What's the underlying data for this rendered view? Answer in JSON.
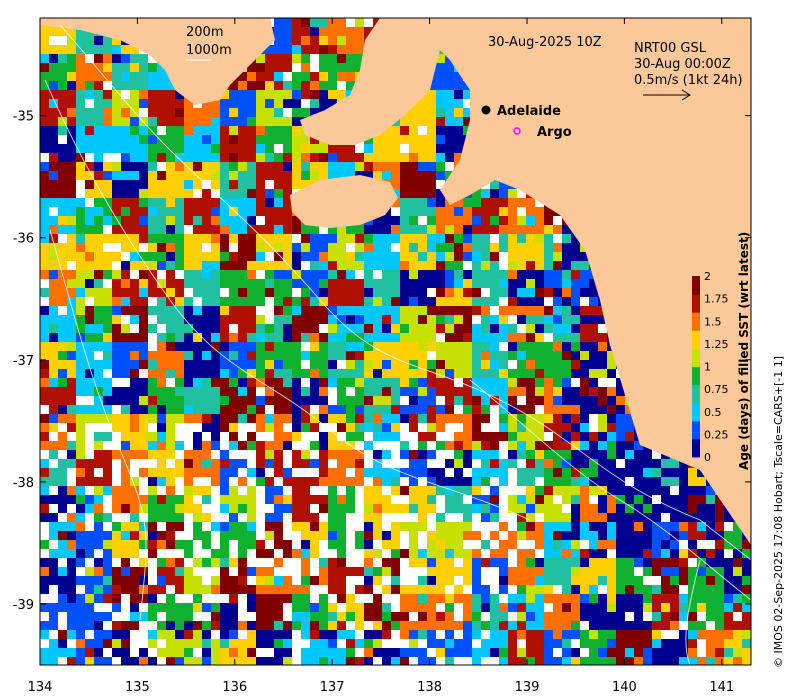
{
  "map": {
    "title_date": "30-Aug-2025 10Z",
    "depth_contours": [
      "200m",
      "1000m"
    ],
    "product": [
      "NRT00 GSL",
      "30-Aug 00:00Z",
      "0.5m/s (1kt 24h)"
    ],
    "places": [
      {
        "name": "Adelaide",
        "marker": "filled-circle",
        "lon": 138.6,
        "lat": -34.93
      },
      {
        "name": "Argo",
        "marker": "magenta-ring",
        "lon": 138.9,
        "lat": -35.12
      }
    ],
    "credit": "© IMOS 02-Sep-2025 17:08 Hobart; Tscale=CARS+[-1 1]",
    "x_ticks": [
      "134",
      "135",
      "136",
      "137",
      "138",
      "139",
      "140",
      "141"
    ],
    "y_ticks": [
      "-35",
      "-36",
      "-37",
      "-38",
      "-39"
    ],
    "lon_range": [
      134,
      141.3
    ],
    "lat_range": [
      -39.5,
      -34.2
    ],
    "colorbar": {
      "title": "Age (days) of filled SST (wrt latest)",
      "ticks": [
        "0",
        "0.25",
        "0.5",
        "0.75",
        "1",
        "1.25",
        "1.5",
        "1.75",
        "2"
      ],
      "range": [
        0,
        2
      ],
      "colors": [
        "#00008f",
        "#0050ff",
        "#00c8ff",
        "#20c0a0",
        "#10b030",
        "#c8e000",
        "#ffd000",
        "#ff7000",
        "#b01000",
        "#800000"
      ]
    },
    "land_color": "#fbc89a"
  }
}
